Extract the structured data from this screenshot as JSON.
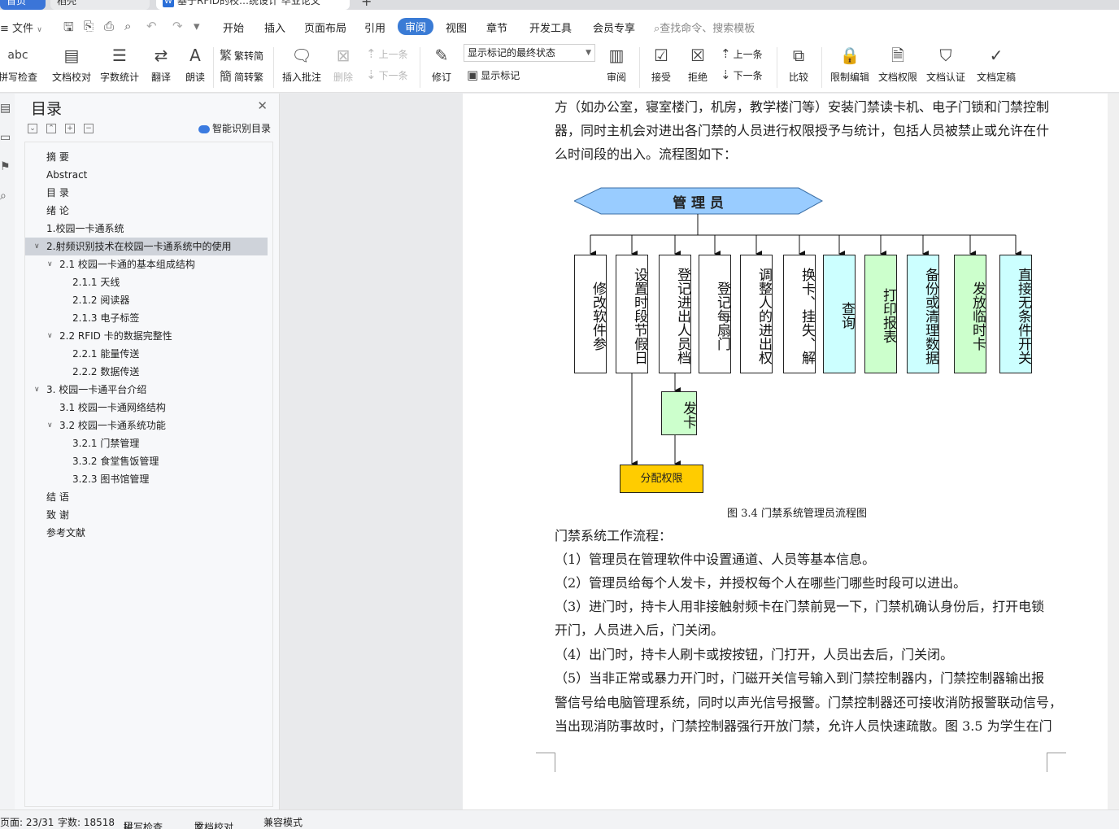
{
  "tabs": {
    "home": "首页",
    "wps": "稻壳",
    "doc": "基于RFID的校…统设计 毕业论文",
    "add": "+"
  },
  "menu": {
    "file": "文件",
    "items": [
      "开始",
      "插入",
      "页面布局",
      "引用",
      "审阅",
      "视图",
      "章节",
      "开发工具",
      "会员专享"
    ],
    "active": "审阅",
    "search": "查找命令、搜索模板"
  },
  "ribbon": {
    "spell": "拼写检查",
    "proof": "文档校对",
    "count": "字数统计",
    "translate": "翻译",
    "read": "朗读",
    "trad": "繁转简",
    "simp": "简转繁",
    "comment": "插入批注",
    "delete": "删除",
    "prev_c": "上一条",
    "next_c": "下一条",
    "revise": "修订",
    "show_state": "显示标记的最终状态",
    "show_mark": "显示标记",
    "review": "审阅",
    "accept": "接受",
    "reject": "拒绝",
    "prev": "上一条",
    "next": "下一条",
    "compare": "比较",
    "restrict": "限制编辑",
    "rights": "文档权限",
    "cert": "文档认证",
    "final": "文档定稿"
  },
  "nav": {
    "title": "目录",
    "smart": "智能识别目录",
    "items": [
      {
        "t": "摘  要",
        "lvl": 1
      },
      {
        "t": "Abstract",
        "lvl": 1
      },
      {
        "t": "目  录",
        "lvl": 1
      },
      {
        "t": "绪  论",
        "lvl": 1
      },
      {
        "t": "1.校园一卡通系统",
        "lvl": 1
      },
      {
        "t": "2.射频识别技术在校园一卡通系统中的使用",
        "lvl": 1,
        "sel": true,
        "tog": true
      },
      {
        "t": "2.1 校园一卡通的基本组成结构",
        "lvl": 2,
        "tog": true
      },
      {
        "t": "2.1.1 天线",
        "lvl": 3
      },
      {
        "t": "2.1.2  阅读器",
        "lvl": 3
      },
      {
        "t": "2.1.3  电子标签",
        "lvl": 3
      },
      {
        "t": "2.2 RFID 卡的数据完整性",
        "lvl": 2,
        "tog": true
      },
      {
        "t": "2.2.1  能量传送",
        "lvl": 3
      },
      {
        "t": "2.2.2  数据传送",
        "lvl": 3
      },
      {
        "t": "3.  校园一卡通平台介绍",
        "lvl": 1,
        "tog": true
      },
      {
        "t": "3.1 校园一卡通网络结构",
        "lvl": 2
      },
      {
        "t": "3.2 校园一卡通系统功能",
        "lvl": 2,
        "tog": true
      },
      {
        "t": "3.2.1 门禁管理",
        "lvl": 3
      },
      {
        "t": "3.3.2 食堂售饭管理",
        "lvl": 3
      },
      {
        "t": "3.2.3 图书馆管理",
        "lvl": 3
      },
      {
        "t": "结  语",
        "lvl": 1
      },
      {
        "t": "致    谢",
        "lvl": 1
      },
      {
        "t": "参考文献",
        "lvl": 1
      }
    ]
  },
  "doc": {
    "lines_top": [
      "方（如办公室，寝室楼门，机房，教学楼门等）安装门禁读卡机、电子门锁和门禁控制",
      "器，同时主机会对进出各门禁的人员进行权限授予与统计，包括人员被禁止或允许在什",
      "么时间段的出入。流程图如下："
    ],
    "caption": "图 3.4    门禁系统管理员流程图",
    "lines_bottom": [
      "门禁系统工作流程：",
      "（1）管理员在管理软件中设置通道、人员等基本信息。",
      "（2）管理员给每个人发卡，并授权每个人在哪些门哪些时段可以进出。",
      "（3）进门时，持卡人用非接触射频卡在门禁前晃一下，门禁机确认身份后，打开电锁",
      "开门，人员进入后，门关闭。",
      "（4）出门时，持卡人刷卡或按按钮，门打开，人员出去后，门关闭。",
      "（5）当非正常或暴力开门时，门磁开关信号输入到门禁控制器内，门禁控制器输出报",
      "警信号给电脑管理系统，同时以声光信号报警。门禁控制器还可接收消防报警联动信号，",
      "当出现消防事故时，门禁控制器强行开放门禁，允许人员快速疏散。图 3.5 为学生在门"
    ]
  },
  "flowchart": {
    "top": "管 理 员",
    "boxes": [
      {
        "t": "修改软件参",
        "color": "#ffffff"
      },
      {
        "t": "设置时段节假日",
        "color": "#ffffff"
      },
      {
        "t": "登记进出人员档",
        "color": "#ffffff"
      },
      {
        "t": "登记每扇门",
        "color": "#ffffff"
      },
      {
        "t": "调整人的进出权",
        "color": "#ffffff"
      },
      {
        "t": "换卡、挂失、解",
        "color": "#ffffff"
      },
      {
        "t": "查询",
        "color": "#ccffff"
      },
      {
        "t": "打印报表",
        "color": "#ccffcc"
      },
      {
        "t": "备份或清理数据",
        "color": "#ccffff"
      },
      {
        "t": "发放临时卡",
        "color": "#ccffcc"
      },
      {
        "t": "直接无条件开关",
        "color": "#ccffff"
      }
    ],
    "issue": "发卡",
    "assign": "分配权限"
  },
  "status": {
    "page": "页面: 23/31",
    "words": "字数: 18518",
    "spell": "拼写检查",
    "proof": "文档校对",
    "compat": "兼容模式"
  }
}
